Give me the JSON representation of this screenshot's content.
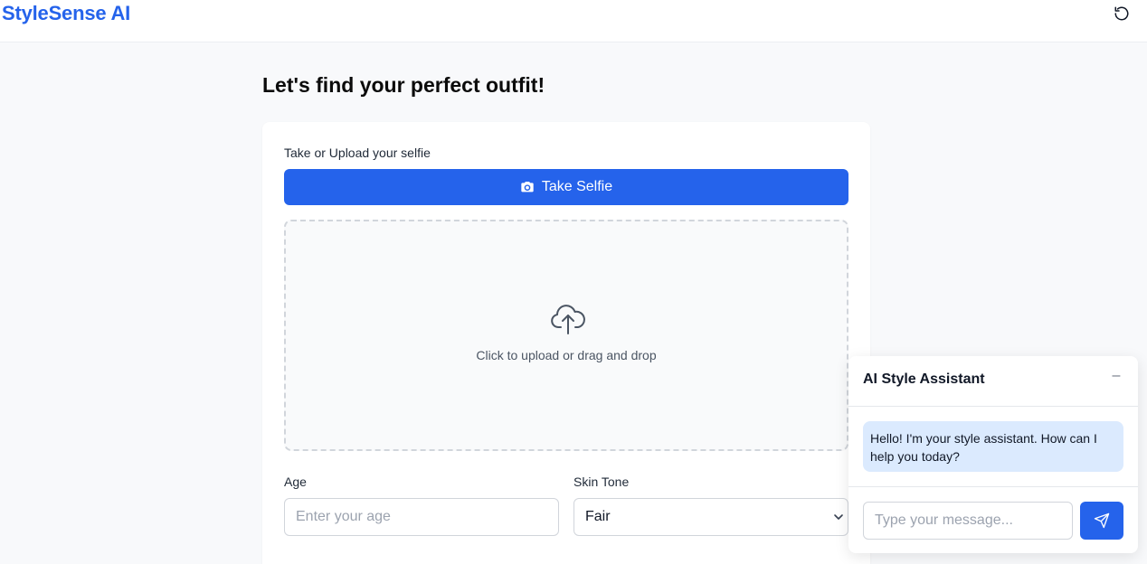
{
  "header": {
    "brand": "StyleSense AI",
    "reset_icon": "refresh-icon"
  },
  "main": {
    "title": "Let's find your perfect outfit!",
    "selfie_label": "Take or Upload your selfie",
    "selfie_button": "Take Selfie",
    "camera_icon": "camera-icon",
    "dropzone_text": "Click to upload or drag and drop",
    "upload_icon": "cloud-upload-icon",
    "age_label": "Age",
    "age_placeholder": "Enter your age",
    "skin_tone_label": "Skin Tone",
    "skin_tone_value": "Fair"
  },
  "chat": {
    "title": "AI Style Assistant",
    "minimize": "–",
    "greeting": "Hello! I'm your style assistant. How can I help you today?",
    "input_placeholder": "Type your message...",
    "send_icon": "send-icon"
  },
  "colors": {
    "accent": "#2563eb",
    "bubble": "#dbeafe",
    "background": "#f8f9fb"
  }
}
